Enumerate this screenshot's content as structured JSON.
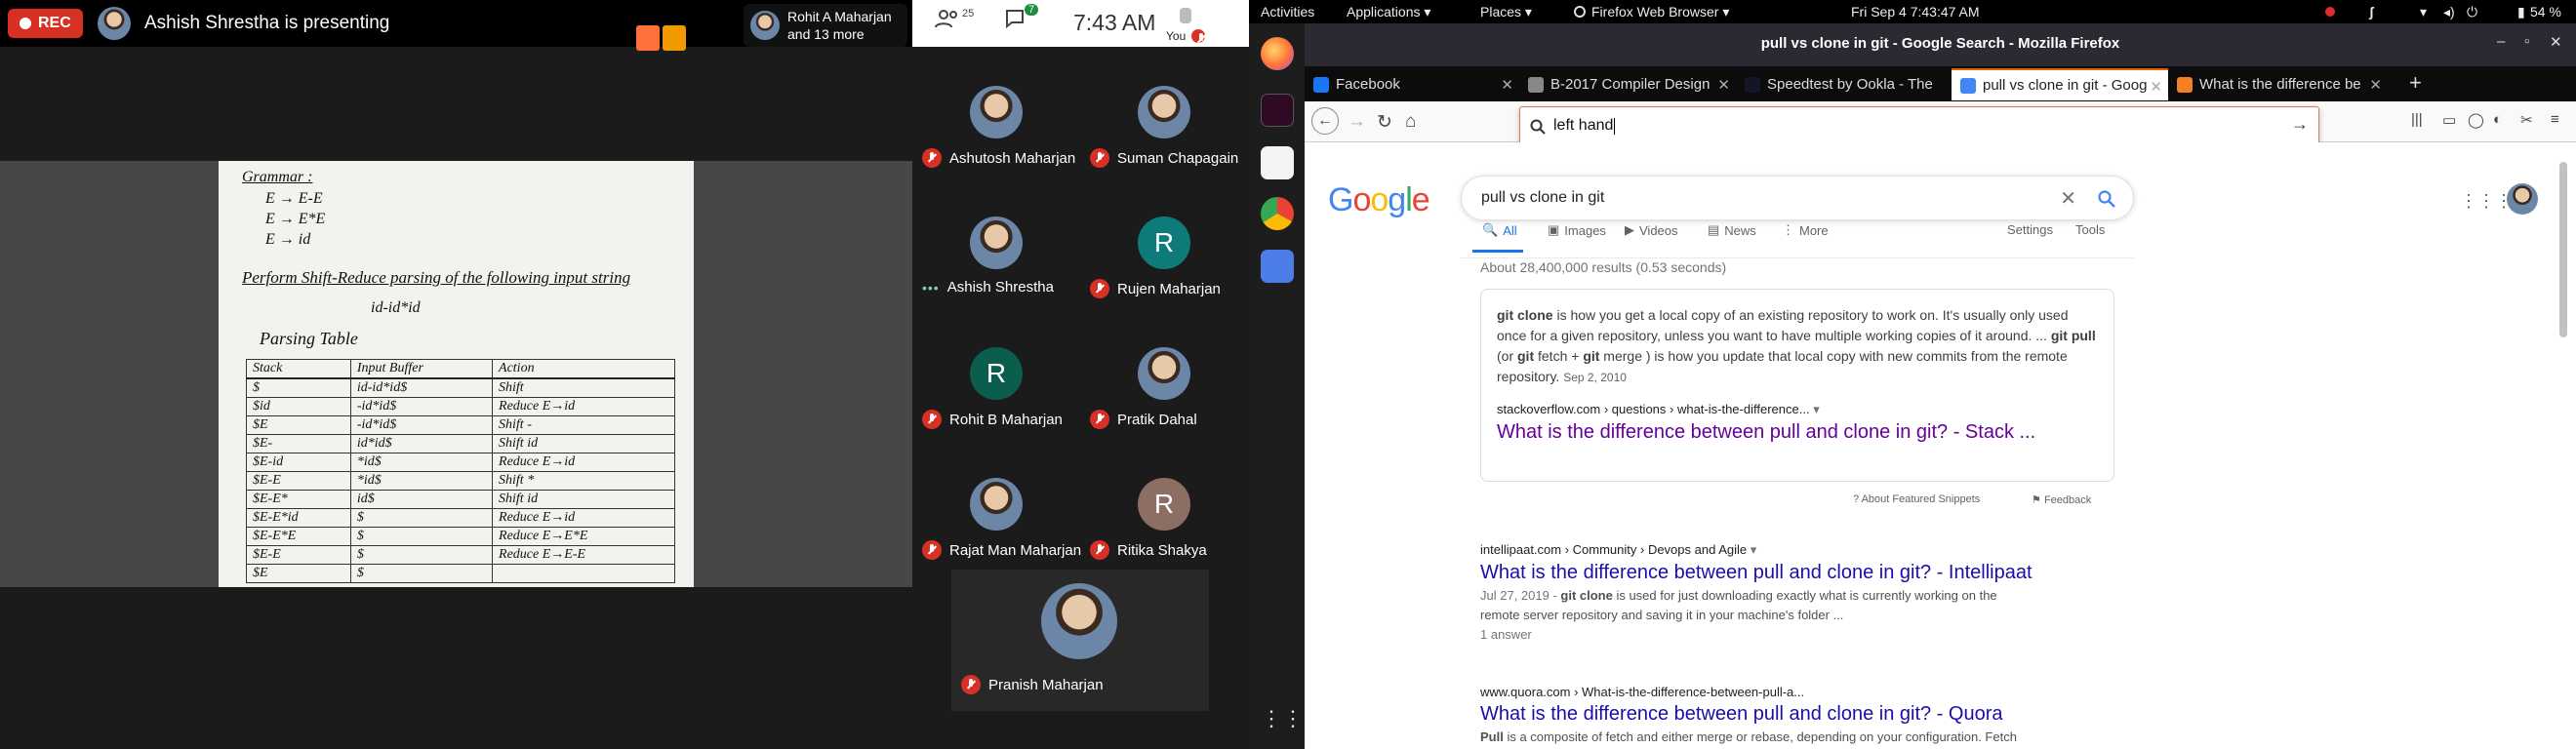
{
  "meet": {
    "rec_label": "REC",
    "presenter_name": "Ashish Shrestha is presenting",
    "participants_chip_line1": "Rohit A Maharjan",
    "participants_chip_line2": "and 13 more",
    "people_count": "25",
    "chat_count": "7",
    "time": "7:43 AM",
    "self_label": "You",
    "tiles": [
      {
        "name": "Ashutosh Maharjan",
        "muted": true,
        "letter": ""
      },
      {
        "name": "Suman Chapagain",
        "muted": true,
        "letter": ""
      },
      {
        "name": "Ashish Shrestha",
        "muted": false,
        "letter": ""
      },
      {
        "name": "Rujen Maharjan",
        "muted": true,
        "letter": "R"
      },
      {
        "name": "Rohit B Maharjan",
        "muted": true,
        "letter": "R"
      },
      {
        "name": "Pratik Dahal",
        "muted": true,
        "letter": ""
      },
      {
        "name": "Rajat Man Maharjan",
        "muted": true,
        "letter": ""
      },
      {
        "name": "Ritika Shakya",
        "muted": true,
        "letter": "R"
      },
      {
        "name": "Pranish Maharjan",
        "muted": true,
        "letter": ""
      }
    ],
    "slide": {
      "grammar_title": "Grammar :",
      "rule1": "E → E-E",
      "rule2": "E → E*E",
      "rule3": "E → id",
      "instruction": "Perform Shift-Reduce parsing of the following input string",
      "input_string": "id-id*id",
      "table_title": "Parsing Table",
      "headers": [
        "Stack",
        "Input Buffer",
        "Action"
      ],
      "rows": [
        [
          "$",
          "id-id*id$",
          "Shift"
        ],
        [
          "$id",
          "-id*id$",
          "Reduce E→id"
        ],
        [
          "$E",
          "-id*id$",
          "Shift -"
        ],
        [
          "$E-",
          "id*id$",
          "Shift id"
        ],
        [
          "$E-id",
          "*id$",
          "Reduce E→id"
        ],
        [
          "$E-E",
          "*id$",
          "Shift *"
        ],
        [
          "$E-E*",
          "id$",
          "Shift id"
        ],
        [
          "$E-E*id",
          "$",
          "Reduce E→id"
        ],
        [
          "$E-E*E",
          "$",
          "Reduce E→E*E"
        ],
        [
          "$E-E",
          "$",
          "Reduce E→E-E"
        ],
        [
          "$E",
          "$",
          ""
        ]
      ]
    }
  },
  "panel": {
    "activities": "Activities",
    "applications": "Applications ▾",
    "places": "Places ▾",
    "app_name": "Firefox Web Browser ▾",
    "clock": "Fri Sep 4   7:43:47 AM",
    "battery": "54 %"
  },
  "firefox": {
    "window_title": "pull vs clone in git - Google Search - Mozilla Firefox",
    "tabs": [
      {
        "title": "Facebook",
        "color": "#1877f2"
      },
      {
        "title": "B-2017 Compiler Design",
        "color": "#888888"
      },
      {
        "title": "Speedtest by Ookla - The",
        "color": "#141526"
      },
      {
        "title": "pull vs clone in git - Goog",
        "color": "#4285f4"
      },
      {
        "title": "What is the difference be",
        "color": "#f48024"
      }
    ],
    "url_popup_text": "left hand",
    "google": {
      "logo": "Google",
      "query": "pull vs clone in git",
      "tabs": [
        "All",
        "Images",
        "Videos",
        "News",
        "More"
      ],
      "settings": "Settings",
      "tools": "Tools",
      "stats": "About 28,400,000 results (0.53 seconds)",
      "snippet_text_a": "git clone",
      "snippet_text_b": " is how you get a local copy of an existing repository to work on. It's usually only used once for a given repository, unless you want to have multiple working copies of it around. ... ",
      "snippet_text_c": "git pull",
      "snippet_text_d": " (or ",
      "snippet_text_e": "git",
      "snippet_text_f": " fetch + ",
      "snippet_text_g": "git",
      "snippet_text_h": " merge ) is how you update that local copy with new commits from the remote repository.",
      "snippet_date": "Sep 2, 2010",
      "snippet_cite": "stackoverflow.com › questions › what-is-the-difference...",
      "snippet_link": "What is the difference between pull and clone in git? - Stack ...",
      "about_snippets": "About Featured Snippets",
      "feedback": "Feedback",
      "results": [
        {
          "cite": "intellipaat.com › Community › Devops and Agile",
          "title": "What is the difference between pull and clone in git? - Intellipaat",
          "desc1_date": "Jul 27, 2019 - ",
          "desc1_bold": "git clone",
          "desc1_rest": " is used for just downloading exactly what is currently working on the",
          "desc2": "remote server repository and saving it in your machine's folder ...",
          "extra": "1 answer"
        },
        {
          "cite": "www.quora.com › What-is-the-difference-between-pull-a...",
          "title": "What is the difference between pull and clone in git? - Quora",
          "desc1_bold": "Pull",
          "desc1_rest": " is a composite of fetch and either merge or rebase, depending on your configuration. Fetch"
        }
      ]
    }
  },
  "colors": {
    "rec": "#d93025",
    "link": "#1a0dab",
    "visited": "#660099",
    "accent": "#e66000"
  }
}
